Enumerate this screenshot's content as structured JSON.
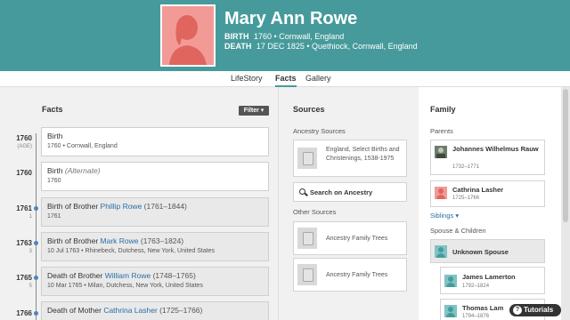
{
  "person": {
    "name": "Mary Ann Rowe",
    "birth_label": "BIRTH",
    "birth_value": "1760 • Cornwall, England",
    "death_label": "DEATH",
    "death_value": "17 DEC 1825 • Quethiock, Cornwall, England"
  },
  "tabs": [
    "LifeStory",
    "Facts",
    "Gallery"
  ],
  "active_tab": "Facts",
  "facts": {
    "title": "Facts",
    "filter_label": "Filter",
    "items": [
      {
        "year": "1760",
        "age": "(AGE)",
        "title": "Birth",
        "detail": "1760 • Cornwall, England"
      },
      {
        "year": "1760",
        "age": "",
        "title": "Birth",
        "alt": "(Alternate)",
        "detail": "1760"
      },
      {
        "year": "1761",
        "age": "1",
        "prefix": "Birth of Brother ",
        "link": "Phillip Rowe",
        "dates": " (1761–1844)",
        "detail": "1761"
      },
      {
        "year": "1763",
        "age": "3",
        "prefix": "Birth of Brother ",
        "link": "Mark Rowe",
        "dates": " (1763–1824)",
        "detail": "10 Jul 1763 • Rhinebeck, Dutchess, New York, United States"
      },
      {
        "year": "1765",
        "age": "5",
        "prefix": "Death of Brother ",
        "link": "William Rowe",
        "dates": " (1748–1765)",
        "detail": "10 Mar 1765 • Milan, Dutchess, New York, United States"
      },
      {
        "year": "1766",
        "age": "",
        "prefix": "Death of Mother ",
        "link": "Cathrina Lasher",
        "dates": " (1725–1766)",
        "detail": ""
      }
    ]
  },
  "sources": {
    "title": "Sources",
    "ancestry_label": "Ancestry Sources",
    "ancestry_items": [
      "England, Select Births and Christenings, 1538-1975"
    ],
    "search_label": "Search on Ancestry",
    "other_label": "Other Sources",
    "other_items": [
      "Ancestry Family Trees",
      "Ancestry Family Trees"
    ]
  },
  "family": {
    "title": "Family",
    "parents_label": "Parents",
    "parents": [
      {
        "name": "Johannes Wilhelmus Rauw",
        "dates": "1732–1771"
      },
      {
        "name": "Cathrina Lasher",
        "dates": "1725–1766"
      }
    ],
    "siblings_label": "Siblings",
    "spouse_label": "Spouse & Children",
    "spouse": "Unknown Spouse",
    "children": [
      {
        "name": "James Lamerton",
        "dates": "1792–1824"
      },
      {
        "name": "Thomas Lam",
        "dates": "1794–1876"
      }
    ]
  },
  "tutorials_label": "Tutorials",
  "colors": {
    "header": "#479a9b",
    "female": "#f29a96",
    "male": "#7fc3c4",
    "link": "#2a6ea6"
  }
}
